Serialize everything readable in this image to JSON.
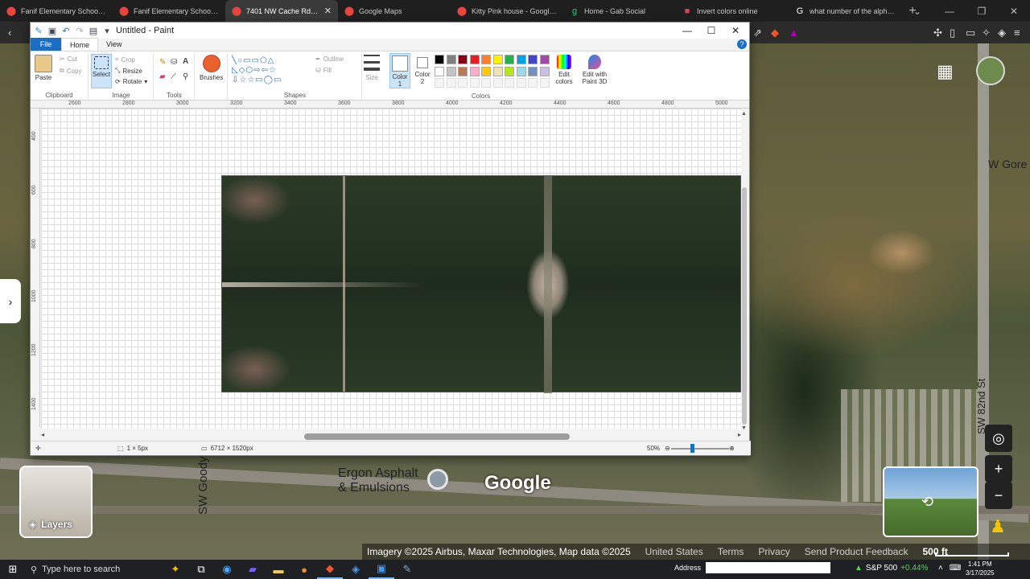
{
  "browser": {
    "tabs": [
      {
        "title": "Fanif Elementary School - Goo",
        "icon": "maps-pin-icon"
      },
      {
        "title": "Fanif Elementary School - Goo",
        "icon": "maps-pin-icon"
      },
      {
        "title": "7401 NW Cache Rd, Lawto",
        "icon": "maps-pin-icon",
        "active": true
      },
      {
        "title": "Google Maps",
        "icon": "maps-pin-icon"
      },
      {
        "title": "Kitty Pink house - Google Maps",
        "icon": "maps-pin-icon"
      },
      {
        "title": "Home - Gab Social",
        "icon": "gab-icon"
      },
      {
        "title": "Invert colors online",
        "icon": "bookmark-icon"
      },
      {
        "title": "what number of the alphabet",
        "icon": "google-icon"
      }
    ]
  },
  "paint": {
    "title": "Untitled - Paint",
    "menu": {
      "file": "File",
      "home": "Home",
      "view": "View"
    },
    "ribbon": {
      "clipboard": {
        "label": "Clipboard",
        "paste": "Paste",
        "cut": "Cut",
        "copy": "Copy"
      },
      "image": {
        "label": "Image",
        "select": "Select",
        "crop": "Crop",
        "resize": "Resize",
        "rotate": "Rotate"
      },
      "tools": {
        "label": "Tools"
      },
      "brushes": "Brushes",
      "shapes": {
        "label": "Shapes",
        "outline": "Outline",
        "fill": "Fill"
      },
      "size": "Size",
      "color1": "Color 1",
      "color2": "Color 2",
      "colors_label": "Colors",
      "edit_colors": "Edit colors",
      "edit_paint3d": "Edit with Paint 3D"
    },
    "palette": [
      "#000000",
      "#7f7f7f",
      "#880015",
      "#ed1c24",
      "#ff7f27",
      "#fff200",
      "#22b14c",
      "#00a2e8",
      "#3f48cc",
      "#a349a4",
      "#ffffff",
      "#c3c3c3",
      "#b97a57",
      "#ffaec9",
      "#ffc90e",
      "#efe4b0",
      "#b5e61d",
      "#99d9ea",
      "#7092be",
      "#c8bfe7"
    ],
    "ruler_top": [
      "2600",
      "2800",
      "3000",
      "3200",
      "3400",
      "3600",
      "3800",
      "4000",
      "4200",
      "4400",
      "4600",
      "4800",
      "5000"
    ],
    "ruler_left": [
      "400",
      "600",
      "800",
      "1000",
      "1200",
      "1400"
    ],
    "status": {
      "selection": "1 × 5px",
      "image_size": "6712 × 1520px",
      "zoom": "50%"
    }
  },
  "map": {
    "labels": {
      "goodyear": "SW Goodyear Blvd",
      "gore": "W Gore",
      "sw82": "SW 82nd St",
      "ergon": "Ergon Asphalt & Emulsions",
      "google": "Google",
      "layers": "Layers"
    },
    "attribution": {
      "imagery": "Imagery ©2025 Airbus, Maxar Technologies, Map data ©2025",
      "country": "United States",
      "terms": "Terms",
      "privacy": "Privacy",
      "feedback": "Send Product Feedback",
      "scale": "500 ft"
    }
  },
  "taskbar": {
    "search_placeholder": "Type here to search",
    "address_label": "Address",
    "ticker_name": "S&P 500",
    "ticker_change": "+0.44%",
    "time": "1:41 PM",
    "date": "3/17/2025"
  }
}
